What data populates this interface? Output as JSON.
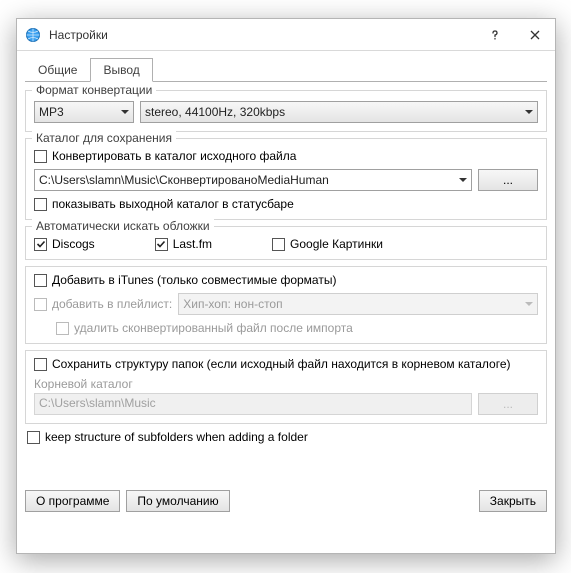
{
  "window": {
    "title": "Настройки"
  },
  "tabs": {
    "general": "Общие",
    "output": "Вывод"
  },
  "format": {
    "group": "Формат конвертации",
    "codec": "MP3",
    "quality": "stereo, 44100Hz, 320kbps"
  },
  "outputDir": {
    "group": "Каталог для сохранения",
    "convertToSource": "Конвертировать в каталог исходного файла",
    "path": "C:\\Users\\slamn\\Music\\СконвертированоMediaHuman",
    "browse": "...",
    "showInStatusbar": "показывать выходной каталог в статусбаре"
  },
  "covers": {
    "group": "Автоматически искать обложки",
    "discogs": "Discogs",
    "lastfm": "Last.fm",
    "google": "Google Картинки"
  },
  "itunes": {
    "add": "Добавить в iTunes (только совместимые форматы)",
    "addToPlaylist": "добавить в плейлист:",
    "playlistValue": "Хип-хоп: нон-стоп",
    "deleteAfter": "удалить сконвертированный файл после импорта"
  },
  "folders": {
    "keepStructure": "Сохранить структуру папок (если исходный файл находится в корневом каталоге)",
    "rootLabel": "Корневой каталог",
    "rootPath": "C:\\Users\\slamn\\Music",
    "browse": "...",
    "keepSubfolders": "keep structure of subfolders when adding a folder"
  },
  "footer": {
    "about": "О программе",
    "defaults": "По умолчанию",
    "close": "Закрыть"
  }
}
